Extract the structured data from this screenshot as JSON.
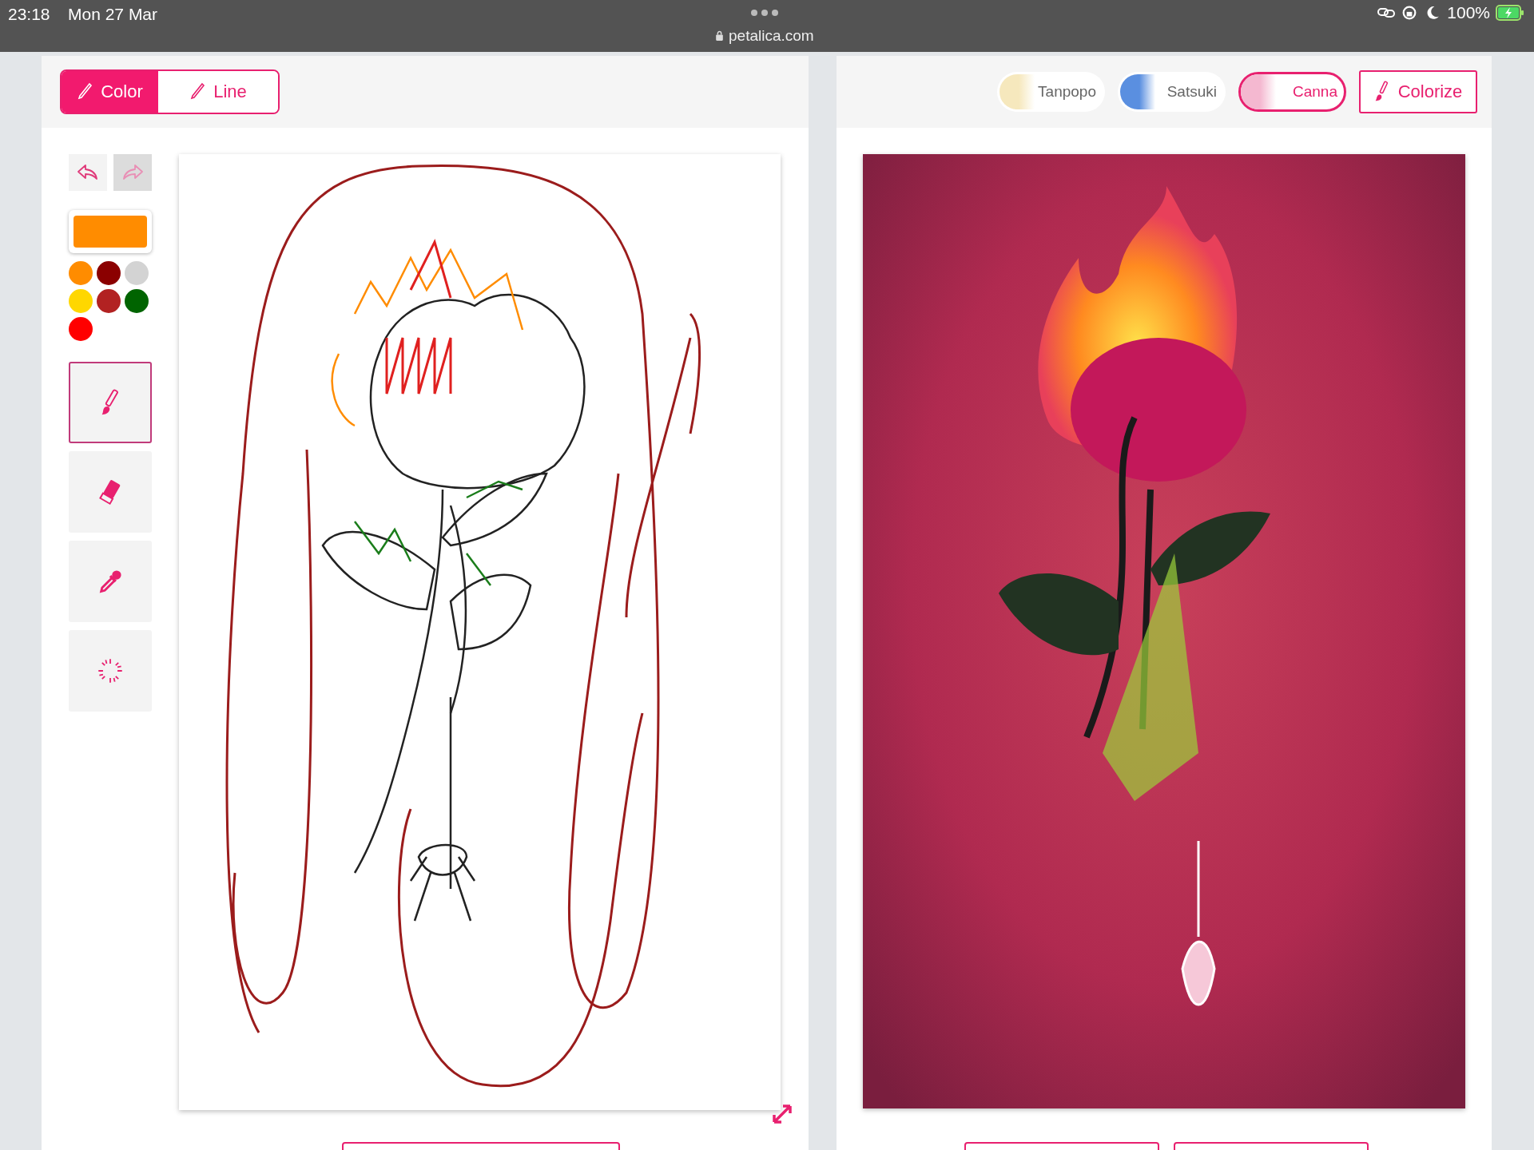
{
  "status_bar": {
    "time": "23:18",
    "date": "Mon 27 Mar",
    "url": "petalica.com",
    "battery": "100%"
  },
  "mode_tabs": [
    {
      "label": "Color",
      "selected": true
    },
    {
      "label": "Line",
      "selected": false
    }
  ],
  "history": [
    {
      "kind": "undo",
      "disabled": false
    },
    {
      "kind": "redo",
      "disabled": true
    }
  ],
  "current_color": {
    "color": "#ff8c00"
  },
  "palette": [
    {
      "color": "#ff8c00"
    },
    {
      "color": "#8b0000"
    },
    {
      "color": "#d3d3d3"
    },
    {
      "color": "#ffd700"
    },
    {
      "color": "#b22222"
    },
    {
      "color": "#006400"
    },
    {
      "color": "#ff0000"
    }
  ],
  "tools": [
    {
      "kind": "brush",
      "selected": true
    },
    {
      "kind": "eraser",
      "selected": false
    },
    {
      "kind": "dropper",
      "selected": false
    },
    {
      "kind": "clear",
      "selected": false
    }
  ],
  "styles": [
    {
      "label": "Tanpopo",
      "selected": false,
      "color": "#f6e8bd"
    },
    {
      "label": "Satsuki",
      "selected": false,
      "color": "#5a8fe0"
    },
    {
      "label": "Canna",
      "selected": true,
      "color": "#f4b8d0"
    }
  ],
  "colorize_button": {
    "label": "Colorize"
  }
}
